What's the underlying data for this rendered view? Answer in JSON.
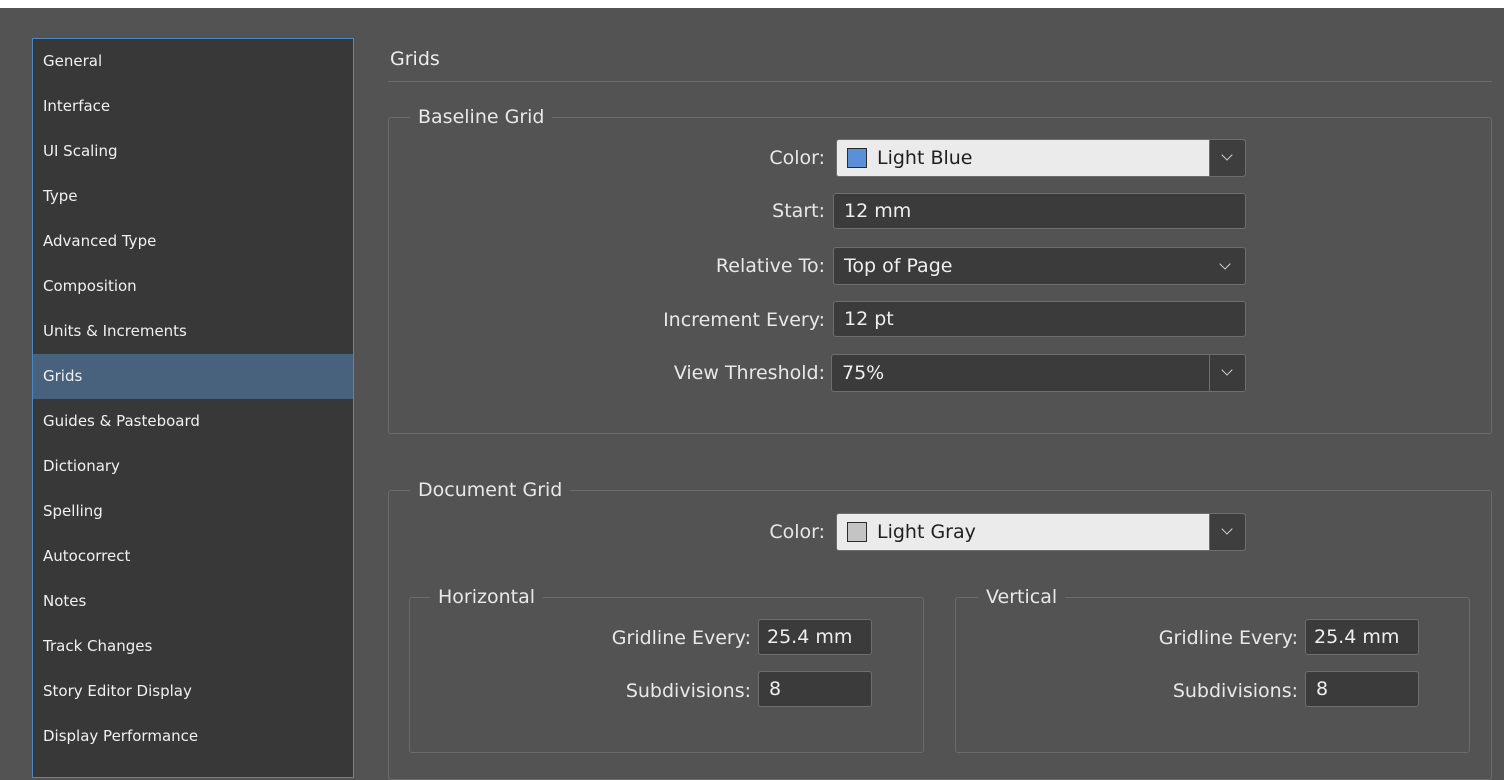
{
  "sidebar": {
    "items": [
      {
        "label": "General"
      },
      {
        "label": "Interface"
      },
      {
        "label": "UI Scaling"
      },
      {
        "label": "Type"
      },
      {
        "label": "Advanced Type"
      },
      {
        "label": "Composition"
      },
      {
        "label": "Units & Increments"
      },
      {
        "label": "Grids",
        "selected": true
      },
      {
        "label": "Guides & Pasteboard"
      },
      {
        "label": "Dictionary"
      },
      {
        "label": "Spelling"
      },
      {
        "label": "Autocorrect"
      },
      {
        "label": "Notes"
      },
      {
        "label": "Track Changes"
      },
      {
        "label": "Story Editor Display"
      },
      {
        "label": "Display Performance"
      }
    ]
  },
  "page": {
    "title": "Grids"
  },
  "baseline_grid": {
    "legend": "Baseline Grid",
    "color_label": "Color:",
    "color_value": "Light Blue",
    "color_swatch": "#5b8fd6",
    "start_label": "Start:",
    "start_value": "12 mm",
    "relative_label": "Relative To:",
    "relative_value": "Top of Page",
    "increment_label": "Increment Every:",
    "increment_value": "12 pt",
    "threshold_label": "View Threshold:",
    "threshold_value": "75%"
  },
  "document_grid": {
    "legend": "Document Grid",
    "color_label": "Color:",
    "color_value": "Light Gray",
    "color_swatch": "#c4c4c4",
    "horizontal": {
      "legend": "Horizontal",
      "gridline_label": "Gridline Every:",
      "gridline_value": "25.4 mm",
      "subdivisions_label": "Subdivisions:",
      "subdivisions_value": "8"
    },
    "vertical": {
      "legend": "Vertical",
      "gridline_label": "Gridline Every:",
      "gridline_value": "25.4 mm",
      "subdivisions_label": "Subdivisions:",
      "subdivisions_value": "8"
    }
  },
  "colors": {
    "panel_bg": "#535353",
    "sidebar_bg": "#383838",
    "sidebar_selected": "#48627d",
    "focus_border": "#4b89c4"
  }
}
